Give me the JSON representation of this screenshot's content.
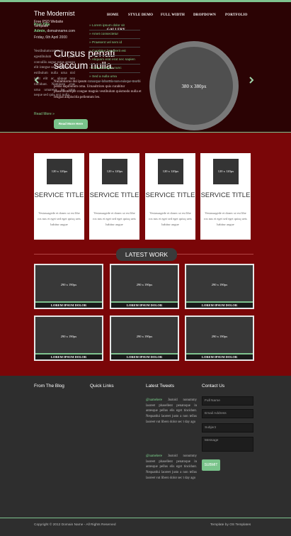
{
  "header": {
    "logo": "The Modernist",
    "tagline": "Free PSD Website Template",
    "nav": [
      "HOME",
      "STYLE DEMO",
      "FULL WIDTH",
      "DROPDOWN",
      "PORTFOLIO",
      "GALLERY"
    ]
  },
  "slider": {
    "title": "Cursus penati saccum nulla.",
    "text": "Nullamlacus dui ipsum conseque loborttis non euisque morbi penas dapibulum orna. Urnaultrices quis curabitur phasellentesque congue magnis vestibulum quismodo nulla et feugiat adipiscitla pellentum leo.",
    "button": "Read More Here",
    "image_label": "380 x 380px"
  },
  "services": [
    {
      "img": "120 x 120px",
      "title": "SERVICE TITLE",
      "text": "Vestassagede et donec ut est libe ros nus et eget sed eget quisq uets habitur augue"
    },
    {
      "img": "120 x 120px",
      "title": "SERVICE TITLE",
      "text": "Vestassagede et donec ut est libe ros nus et eget sed eget quisq uets habitur augue"
    },
    {
      "img": "120 x 120px",
      "title": "SERVICE TITLE",
      "text": "Vestassagede et donec ut est libe ros nus et eget sed eget quisq uets habitur augue"
    },
    {
      "img": "120 x 120px",
      "title": "SERVICE TITLE",
      "text": "Vestassagede et donec ut est libe ros nus et eget sed eget quisq uets habitur augue"
    }
  ],
  "latest_work": {
    "title": "LATEST WORK",
    "items": [
      {
        "size": "290 x 190px",
        "caption": "LOREM IPSUM DOLOR"
      },
      {
        "size": "290 x 190px",
        "caption": "LOREM IPSUM DOLOR"
      },
      {
        "size": "290 x 190px",
        "caption": "LOREM IPSUM DOLOR"
      },
      {
        "size": "290 x 190px",
        "caption": "LOREM IPSUM DOLOR"
      },
      {
        "size": "290 x 190px",
        "caption": "LOREM IPSUM DOLOR"
      },
      {
        "size": "290 x 190px",
        "caption": "LOREM IPSUM DOLOR"
      }
    ]
  },
  "footer": {
    "blog": {
      "heading": "From The Blog",
      "post_title": "Post Title",
      "author_label": "Admin,",
      "author_site": "domainname.com",
      "date": "Friday, 6th April 2000",
      "text": "Vestibulumcommum egestibulum eu justo convallis augue estas aenean elit integue sed. Facilisigeda estibulum nulla urna nisl velit elit ac aliquat non tincidunt. Namjusto cras urna urnaretra lor urna neque sed quis orci nulla.",
      "more": "Read More »"
    },
    "quick_links": {
      "heading": "Quick Links",
      "items": [
        "Lorem ipsum dolor sit",
        "Amet consectetur",
        "Praesent vel sem id",
        "Curabitur hendrerit est",
        "Aliquam erat erat nec sapien",
        "Cras id augue nunc",
        "Sed a nulla urna"
      ]
    },
    "tweets": {
      "heading": "Latest Tweets",
      "items": [
        {
          "handle": "@namehere",
          "text": "Justoid nonummy laoreet phasellent penatoque in antesque pellus elis eget tincidunt. Nequatdui laoreet justo a non tellus laoreet vut libero dolor sec t day ago"
        },
        {
          "handle": "@namehere",
          "text": "Justoid nonummy laoreet phasellent penatoque in antesque pellus elis eget tincidunt. Nequatdui laoreet justo a non tellus laoreet vut libero dolor sec t day ago"
        }
      ]
    },
    "contact": {
      "heading": "Contact Us",
      "name_placeholder": "Full Name",
      "email_placeholder": "Email Address",
      "subject_placeholder": "Subject",
      "message_placeholder": "Message",
      "submit": "SUBMIT"
    },
    "copyright": "Copyright © 2012 Domain Name - All Rights Reserved",
    "credit": "Template by OS Templates"
  },
  "colors": {
    "accent": "#7fc38f",
    "body_bg": "#7a0608",
    "hero_bg": "#2b0304",
    "footer_bg": "#2e2e2e"
  }
}
